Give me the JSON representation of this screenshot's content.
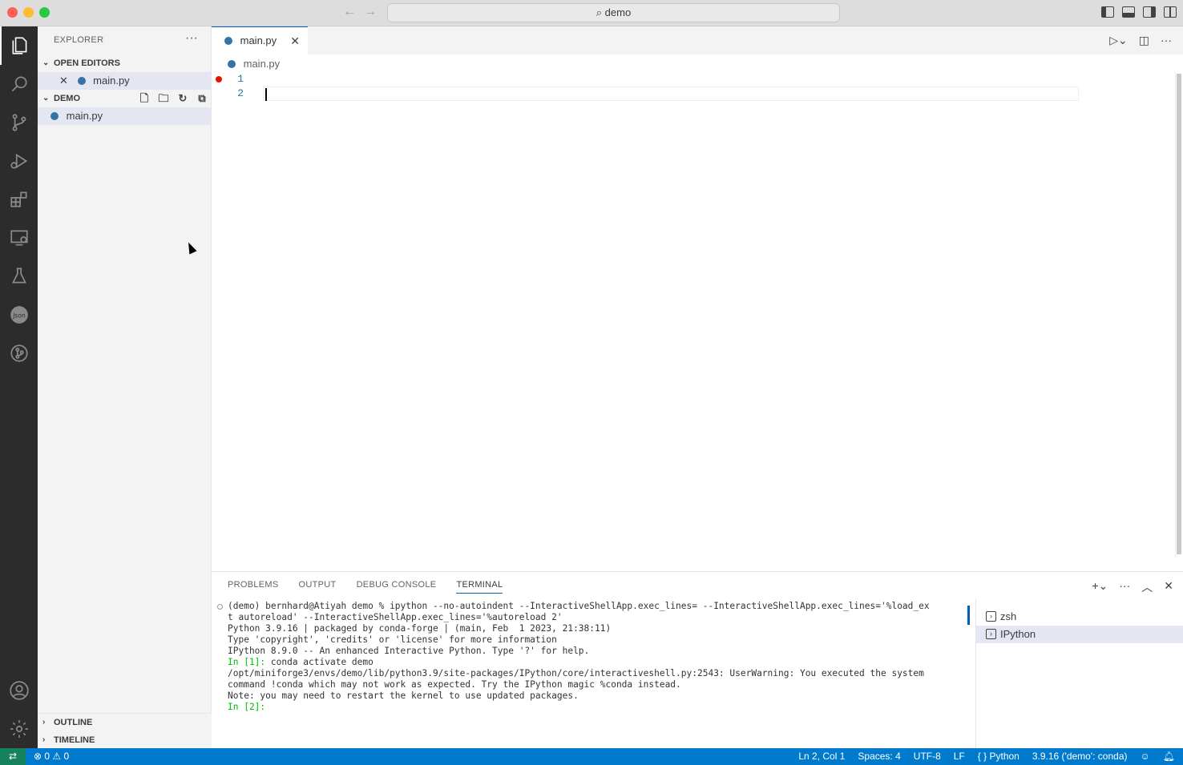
{
  "window": {
    "search_label": "⌕ demo"
  },
  "sidebar": {
    "title": "EXPLORER",
    "more": "···",
    "open_editors": {
      "label": "OPEN EDITORS",
      "file": "main.py"
    },
    "workspace": {
      "label": "DEMO",
      "file": "main.py"
    },
    "outline": "OUTLINE",
    "timeline": "TIMELINE"
  },
  "editor": {
    "tab_label": "main.py",
    "breadcrumb": "main.py",
    "line_numbers": [
      "1",
      "2"
    ]
  },
  "panel": {
    "tabs": [
      "PROBLEMS",
      "OUTPUT",
      "DEBUG CONSOLE",
      "TERMINAL"
    ],
    "active_tab": "TERMINAL",
    "terminal_lines": [
      "(demo) bernhard@Atiyah demo % ipython --no-autoindent --InteractiveShellApp.exec_lines= --InteractiveShellApp.exec_lines='%load_ex",
      "t autoreload' --InteractiveShellApp.exec_lines='%autoreload 2'",
      "Python 3.9.16 | packaged by conda-forge | (main, Feb  1 2023, 21:38:11)",
      "Type 'copyright', 'credits' or 'license' for more information",
      "IPython 8.9.0 -- An enhanced Interactive Python. Type '?' for help.",
      "",
      "In [1]: conda activate demo",
      "/opt/miniforge3/envs/demo/lib/python3.9/site-packages/IPython/core/interactiveshell.py:2543: UserWarning: You executed the system",
      "command !conda which may not work as expected. Try the IPython magic %conda instead.",
      "",
      "Note: you may need to restart the kernel to use updated packages.",
      "",
      "In [2]:"
    ],
    "terminals": [
      "zsh",
      "IPython"
    ]
  },
  "statusbar": {
    "problems": "⊗ 0 ⚠ 0",
    "position": "Ln 2, Col 1",
    "spaces": "Spaces: 4",
    "encoding": "UTF-8",
    "eol": "LF",
    "language": "{ } Python",
    "interpreter": "3.9.16 ('demo': conda)"
  },
  "colors": {
    "accent": "#007acc",
    "activity_bar": "#2c2c2c",
    "breakpoint": "#e51400"
  }
}
